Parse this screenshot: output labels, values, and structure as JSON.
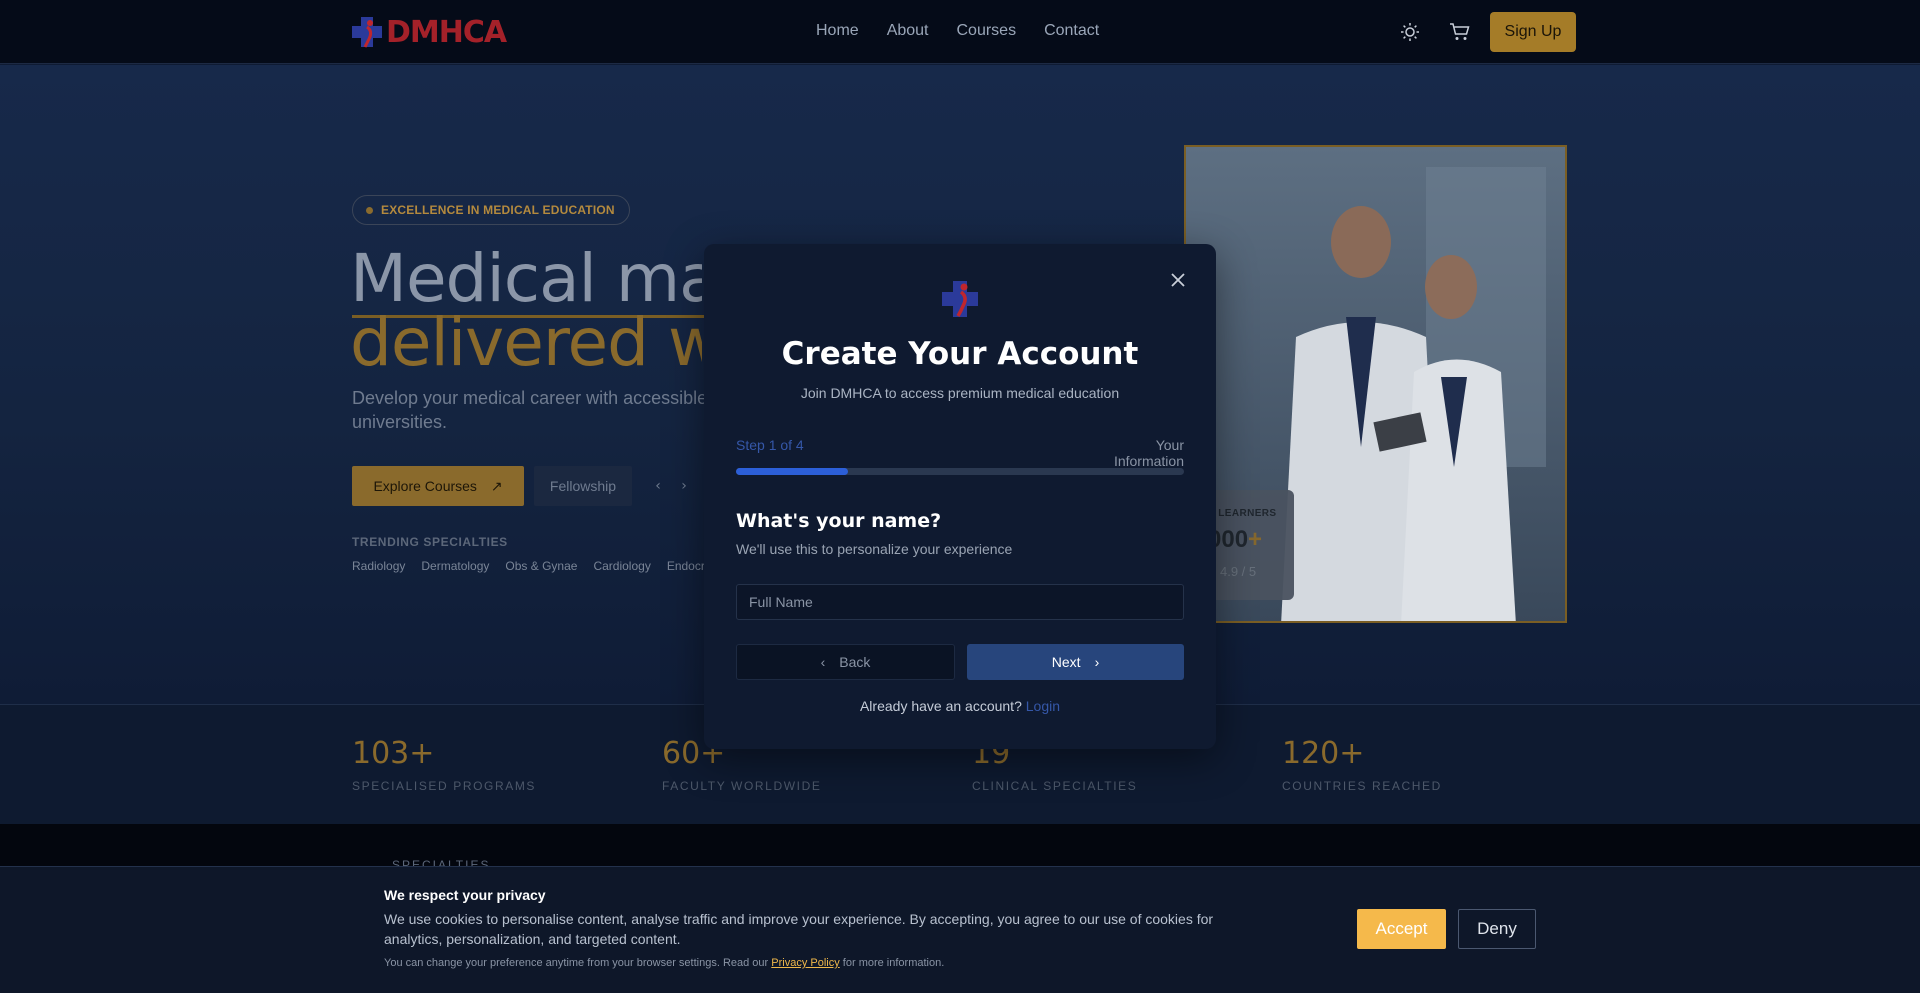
{
  "header": {
    "logo_text": "DMHCA",
    "nav": [
      "Home",
      "About",
      "Courses",
      "Contact"
    ],
    "signup_label": "Sign Up"
  },
  "hero": {
    "badge": "EXCELLENCE IN MEDICAL EDUCATION",
    "headline_line1": "Medical mas",
    "headline_line2": "delivered wi",
    "subtext_line1": "Develop your medical career with accessible",
    "subtext_line2": "universities.",
    "explore_label": "Explore Courses",
    "fellowship_label": "Fellowship",
    "trending_label": "TRENDING SPECIALTIES",
    "trending": [
      "Radiology",
      "Dermatology",
      "Obs & Gynae",
      "Cardiology",
      "Endocri"
    ],
    "learners_label": "E LEARNERS",
    "learners_value": "000",
    "learners_plus": "+",
    "rating": "4.9 / 5"
  },
  "stats": [
    {
      "value": "103+",
      "label": "SPECIALISED PROGRAMS"
    },
    {
      "value": "60+",
      "label": "FACULTY WORLDWIDE"
    },
    {
      "value": "19",
      "label": "CLINICAL SPECIALTIES"
    },
    {
      "value": "120+",
      "label": "COUNTRIES REACHED"
    }
  ],
  "specialties_label": "SPECIALTIES",
  "modal": {
    "title": "Create Your Account",
    "subtitle": "Join DMHCA to access premium medical education",
    "step_label": "Step 1 of 4",
    "step_name": "Your Information",
    "progress": 0.25,
    "question": "What's your name?",
    "question_sub": "We'll use this to personalize your experience",
    "input_placeholder": "Full Name",
    "input_value": "",
    "back_label": "Back",
    "next_label": "Next",
    "have_account": "Already have an account?",
    "login_label": "Login"
  },
  "cookie": {
    "title": "We respect your privacy",
    "text": "We use cookies to personalise content, analyse traffic and improve your experience. By accepting, you agree to our use of cookies for analytics, personalization, and targeted content.",
    "note_before": "You can change your preference anytime from your browser settings. Read our",
    "privacy_link": "Privacy Policy",
    "note_after": "for more information.",
    "accept_label": "Accept",
    "deny_label": "Deny"
  },
  "colors": {
    "gold": "#a57c28",
    "accent_blue": "#2c5fd8",
    "accept": "#f5b94b",
    "brand_red": "#c0262d"
  },
  "icons": [
    "sun-icon",
    "cart-icon",
    "arrow-up-right-icon",
    "close-icon",
    "chevron-left-icon",
    "chevron-right-icon",
    "medical-cross-logo-icon"
  ]
}
